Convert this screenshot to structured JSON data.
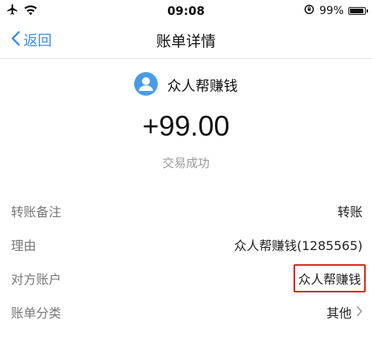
{
  "status_bar": {
    "time": "09:08",
    "battery_text": "99%",
    "battery_level": 0.99,
    "icons": [
      "airplane-icon",
      "wifi-icon",
      "orientation-lock-icon",
      "battery-icon"
    ]
  },
  "nav": {
    "back_label": "返回",
    "title": "账单详情"
  },
  "transaction": {
    "payer_name": "众人帮赚钱",
    "amount": "+99.00",
    "status": "交易成功"
  },
  "details": [
    {
      "label": "转账备注",
      "value": "转账"
    },
    {
      "label": "理由",
      "value": "众人帮赚钱(1285565)"
    },
    {
      "label": "对方账户",
      "value": "众人帮赚钱"
    },
    {
      "label": "账单分类",
      "value": "其他"
    }
  ],
  "colors": {
    "accent": "#3a8ee6",
    "highlight_border": "#e02020",
    "muted_text": "#999999"
  }
}
